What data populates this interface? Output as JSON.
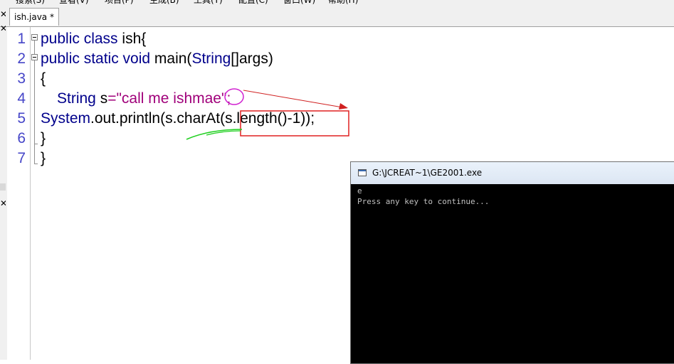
{
  "menu": {
    "items": [
      "搜索(S)",
      "查看(V)",
      "项目(P)",
      "生成(B)",
      "工具(T)",
      "配置(C)",
      "窗口(W)",
      "帮助(H)"
    ]
  },
  "tab": {
    "label": "ish.java *"
  },
  "side_marks": {
    "close": "✕"
  },
  "editor": {
    "line_numbers": [
      "1",
      "2",
      "3",
      "4",
      "5",
      "6",
      "7"
    ],
    "code": {
      "l1_kw": "public class",
      "l1_rest": " ish{",
      "l2_kw1": "public static void",
      "l2_rest1": " main(",
      "l2_kw2": "String",
      "l2_rest2": "[]args)",
      "l3": "{",
      "l4_kw": "String",
      "l4_var": " s",
      "l4_eq": "=",
      "l4_str": "\"call me ishmae\"",
      "l4_semi": ";",
      "l5_kw": "System",
      "l5_rest": ".out.println(s.charAt(s.length()-1));",
      "l6": "}",
      "l7": "}"
    }
  },
  "console": {
    "title": "G:\\JCREAT~1\\GE2001.exe",
    "output": [
      "e",
      "Press any key to continue..."
    ]
  },
  "annotation_colors": {
    "circle": "#d020d0",
    "arrow": "#d02020",
    "box": "#e02020",
    "underline": "#20d020"
  }
}
